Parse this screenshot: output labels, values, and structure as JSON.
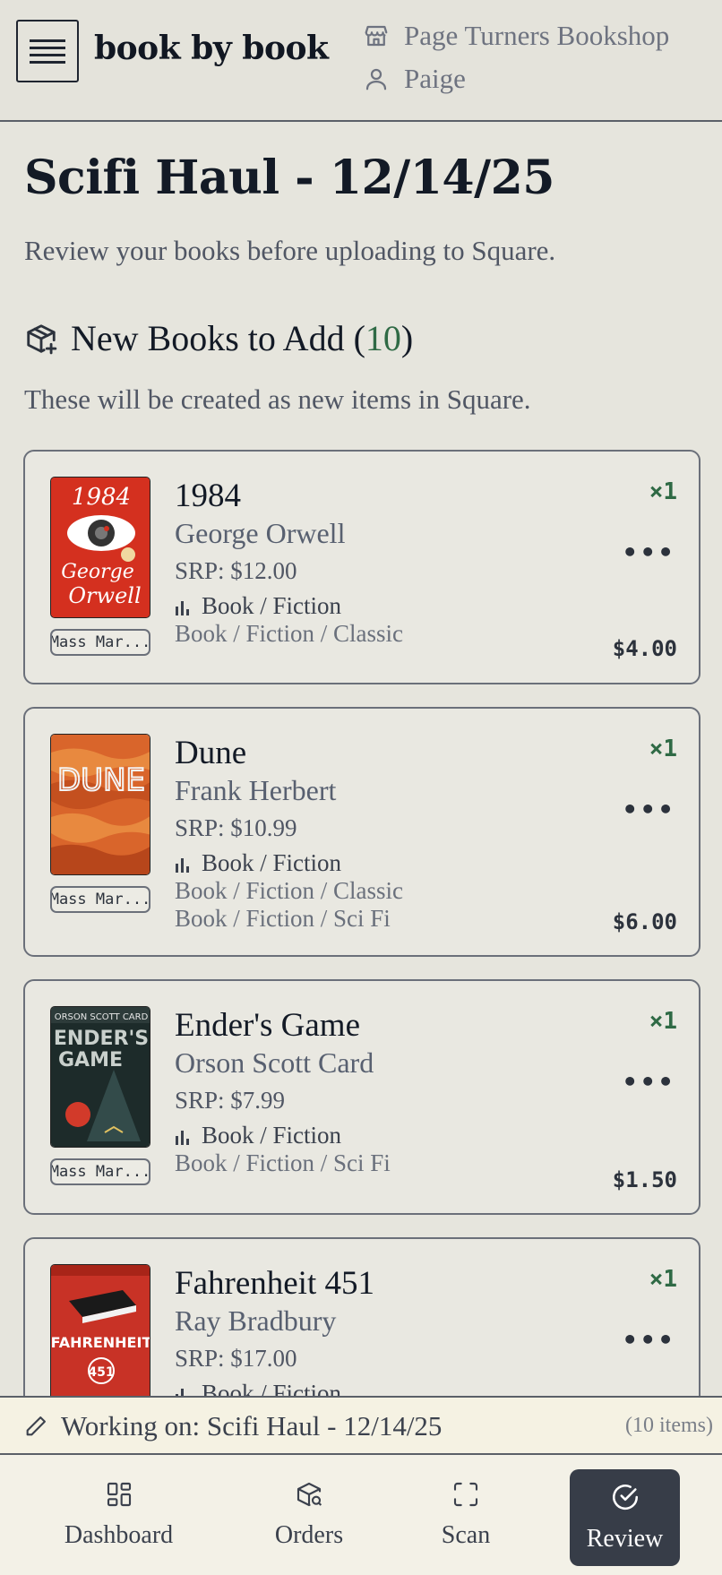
{
  "header": {
    "brand": "book by book",
    "shop_name": "Page Turners Bookshop",
    "user_name": "Paige"
  },
  "page": {
    "title": "Scifi Haul - 12/14/25",
    "subtitle": "Review your books before uploading to Square."
  },
  "section": {
    "heading_prefix": "New Books to Add (",
    "count": "10",
    "heading_suffix": ")",
    "description": "These will be created as new items in Square."
  },
  "books": [
    {
      "title": "1984",
      "author": "George Orwell",
      "srp": "SRP: $12.00",
      "category": "Book / Fiction",
      "categories": [
        "Book / Fiction / Classic"
      ],
      "format": "Mass Mar...",
      "qty": "×1",
      "price": "$4.00",
      "cover_text": [
        "1984",
        "George",
        "Orwell"
      ]
    },
    {
      "title": "Dune",
      "author": "Frank Herbert",
      "srp": "SRP: $10.99",
      "category": "Book / Fiction",
      "categories": [
        "Book / Fiction / Classic",
        "Book / Fiction / Sci Fi"
      ],
      "format": "Mass Mar...",
      "qty": "×1",
      "price": "$6.00",
      "cover_text": [
        "DUNE"
      ]
    },
    {
      "title": "Ender's Game",
      "author": "Orson Scott Card",
      "srp": "SRP: $7.99",
      "category": "Book / Fiction",
      "categories": [
        "Book / Fiction / Sci Fi"
      ],
      "format": "Mass Mar...",
      "qty": "×1",
      "price": "$1.50",
      "cover_text": [
        "ORSON SCOTT CARD",
        "ENDER'S",
        "GAME"
      ]
    },
    {
      "title": "Fahrenheit 451",
      "author": "Ray Bradbury",
      "srp": "SRP: $17.00",
      "category": "Book / Fiction",
      "qty": "×1",
      "cover_text": [
        "FAHRENHEIT",
        "451"
      ]
    }
  ],
  "working": {
    "label": "Working on: Scifi Haul - 12/14/25",
    "items": "(10 items)"
  },
  "nav": {
    "dashboard": "Dashboard",
    "orders": "Orders",
    "scan": "Scan",
    "review": "Review"
  },
  "colors": {
    "accent_green": "#2f6a45",
    "active_nav": "#373d48",
    "background": "#e6e5dd"
  },
  "icons": [
    "menu-icon",
    "store-icon",
    "user-icon",
    "package-add-icon",
    "bar-chart-icon",
    "more-icon",
    "pencil-icon",
    "dashboard-icon",
    "orders-icon",
    "scan-icon",
    "check-circle-icon"
  ]
}
